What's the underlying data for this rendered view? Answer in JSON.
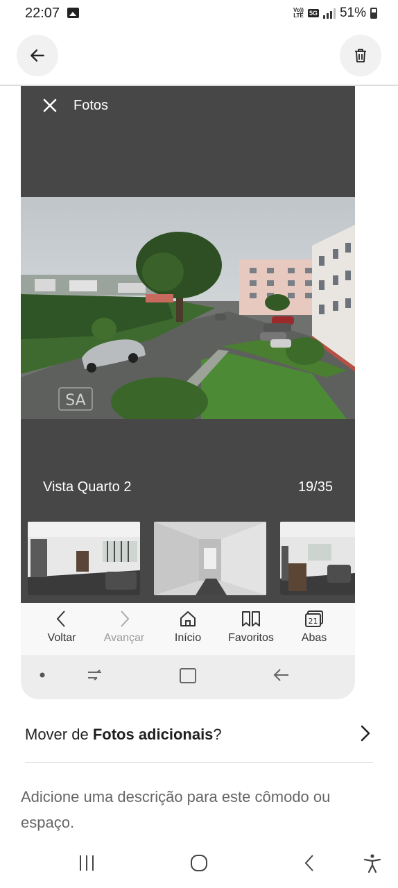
{
  "status_bar": {
    "time": "22:07",
    "network_top": "Vo))",
    "network_bottom": "LTE",
    "network_type": "5G",
    "battery": "51%"
  },
  "icons": {
    "back": "arrow-left-icon",
    "delete": "trash-icon",
    "close": "close-icon",
    "move_chevron": "chevron-right-icon"
  },
  "viewer": {
    "title": "Fotos",
    "caption": "Vista Quarto 2",
    "counter": "19/35",
    "watermark": "SA"
  },
  "browser_nav": {
    "items": [
      {
        "label": "Voltar",
        "icon": "chevron-left-icon",
        "enabled": true
      },
      {
        "label": "Avançar",
        "icon": "chevron-right-icon",
        "enabled": false
      },
      {
        "label": "Início",
        "icon": "home-icon",
        "enabled": true
      },
      {
        "label": "Favoritos",
        "icon": "bookmarks-icon",
        "enabled": true
      },
      {
        "label": "Abas",
        "icon": "tabs-icon",
        "enabled": true,
        "badge": "21"
      }
    ]
  },
  "move": {
    "prefix": "Mover de ",
    "bold": "Fotos adicionais",
    "suffix": "?"
  },
  "description": {
    "placeholder": "Adicione uma descrição para este cômodo ou espaço."
  },
  "colors": {
    "viewer_bg": "#474747",
    "browser_bar_bg": "#f8f8f8"
  }
}
